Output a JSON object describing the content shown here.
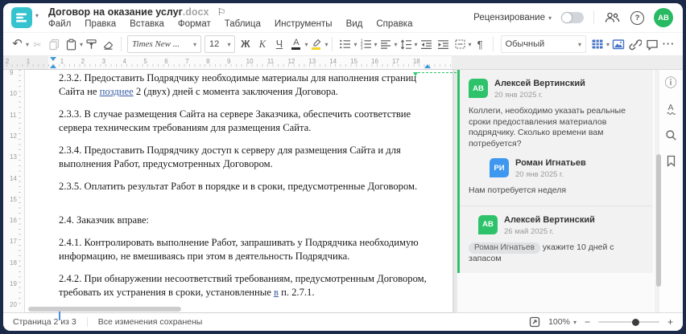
{
  "window": {
    "title": "Договор на оказание услуг",
    "title_ext": ".docx"
  },
  "menu": {
    "items": [
      "Файл",
      "Правка",
      "Вставка",
      "Формат",
      "Таблица",
      "Инструменты",
      "Вид",
      "Справка"
    ]
  },
  "header_right": {
    "review_label": "Рецензирование",
    "avatar_initials": "АВ"
  },
  "toolbar": {
    "font_name": "Times New ...",
    "font_size": "12",
    "bold": "Ж",
    "italic": "К",
    "underline": "Ч",
    "color_letter": "А",
    "style_name": "Обычный"
  },
  "icons": {
    "undo": "↶",
    "cut": "✂",
    "pilcrow": "¶",
    "more": "···",
    "flag": "⚐",
    "caret": "▾",
    "minus": "−",
    "plus": "+",
    "help": "?",
    "info": "ⓘ",
    "spell_letter": "А"
  },
  "ruler": {
    "h_left": [
      "2",
      "1"
    ],
    "h_main": [
      "1",
      "2",
      "3",
      "4",
      "5",
      "6",
      "7",
      "8",
      "9",
      "10",
      "11",
      "12",
      "13",
      "14",
      "15",
      "16",
      "17",
      "18"
    ],
    "v": [
      "9",
      "10",
      "11",
      "12",
      "13",
      "14",
      "15",
      "16",
      "17",
      "18",
      "19",
      "20"
    ]
  },
  "document": {
    "paragraphs": [
      {
        "segments": [
          {
            "t": "2.3.2. Предоставить Подрядчику необходимые материалы для наполнения страниц Сайта не "
          },
          {
            "t": "позднее",
            "ins": true
          },
          {
            "t": " 2 (двух) дней с момента заключения Договора."
          }
        ]
      },
      {
        "segments": [
          {
            "t": "2.3.3. В случае размещения Сайта на сервере Заказчика, обеспечить соответствие сервера техническим требованиям для размещения Сайта."
          }
        ]
      },
      {
        "segments": [
          {
            "t": "2.3.4. Предоставить Подрядчику доступ к серверу для размещения Сайта и для выполнения Работ, предусмотренных Договором."
          }
        ]
      },
      {
        "segments": [
          {
            "t": "2.3.5. Оплатить результат Работ в порядке и в сроки, предусмотренные Договором."
          }
        ]
      },
      {
        "space_before": true,
        "segments": [
          {
            "t": "2.4. Заказчик вправе:"
          }
        ]
      },
      {
        "segments": [
          {
            "t": "2.4.1. Контролировать выполнение Работ, запрашивать у Подрядчика необходимую информацию, не вмешиваясь при этом в деятельность Подрядчика."
          }
        ]
      },
      {
        "segments": [
          {
            "t": "2.4.2. При обнаружении несоответствий требованиям, предусмотренным Договором, требовать их устранения в сроки, установленные "
          },
          {
            "t": "в",
            "ins": true
          },
          {
            "t": " п. 2.7.1."
          }
        ]
      }
    ],
    "caret": true
  },
  "comments": {
    "threads": [
      {
        "items": [
          {
            "initials": "АВ",
            "color": "#2ec36b",
            "name": "Алексей Вертинский",
            "date": "20 янв 2025 г.",
            "text": "Коллеги, необходимо указать реальные сроки предоставления материалов подрядчику. Сколько времени вам потребуется?",
            "indent": 0
          },
          {
            "initials": "РИ",
            "color": "#3f98f0",
            "name": "Роман Игнатьев",
            "date": "20 янв 2025 г.",
            "text": "Нам потребуется неделя",
            "indent": 26
          }
        ]
      },
      {
        "items": [
          {
            "initials": "АВ",
            "color": "#2ec36b",
            "name": "Алексей Вертинский",
            "date": "26 май 2025 г.",
            "mention": "Роман Игнатьев",
            "text": "укажите 10 дней с запасом",
            "indent": 12
          }
        ]
      }
    ]
  },
  "statusbar": {
    "page_label": "Страница 2 из 3",
    "saved_label": "Все изменения сохранены",
    "zoom_value": "100%"
  }
}
